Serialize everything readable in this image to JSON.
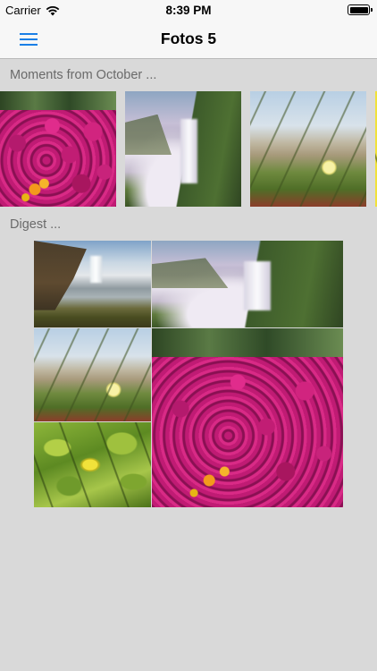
{
  "status_bar": {
    "carrier": "Carrier",
    "time": "8:39 PM"
  },
  "nav": {
    "title": "Fotos 5",
    "menu_icon": "hamburger-menu-icon",
    "accent_color": "#1a7fe6"
  },
  "moments": {
    "header": "Moments from October ..."
  },
  "digest": {
    "header": "Digest ..."
  }
}
